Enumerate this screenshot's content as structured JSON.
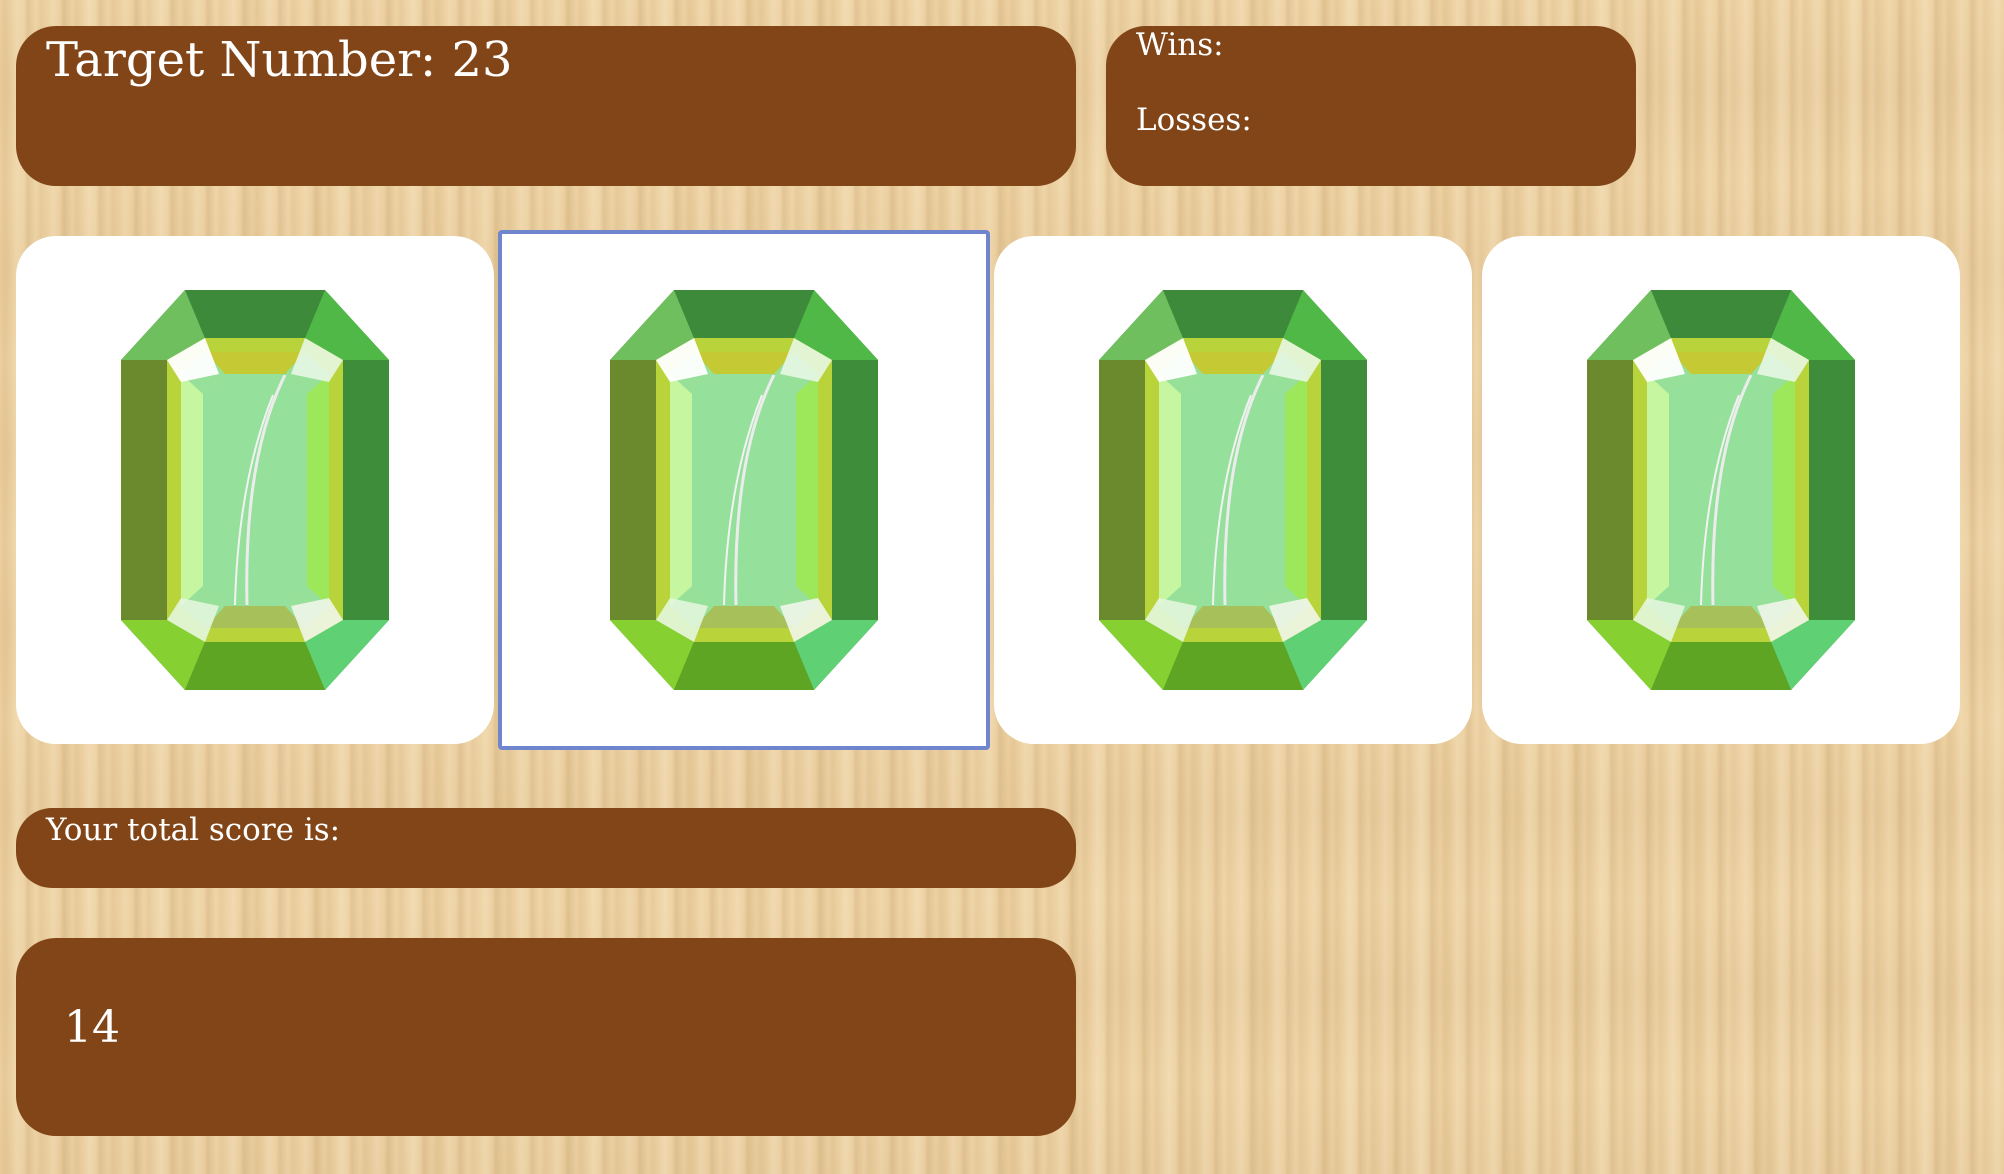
{
  "target": {
    "label": "Target Number:",
    "value": "23"
  },
  "stats": {
    "wins_label": "Wins:",
    "wins_value": "",
    "losses_label": "Losses:",
    "losses_value": ""
  },
  "score": {
    "label": "Your total score is:",
    "value": "14"
  },
  "crystals": [
    {
      "icon": "green-gem-icon",
      "focused": false
    },
    {
      "icon": "green-gem-icon",
      "focused": true
    },
    {
      "icon": "green-gem-icon",
      "focused": false
    },
    {
      "icon": "green-gem-icon",
      "focused": false
    }
  ],
  "colors": {
    "panel": "#824517",
    "focus_ring": "#6f86cf",
    "gem_dark": "#3e8a3a",
    "gem_mid": "#55c24a",
    "gem_light": "#97e09a",
    "gem_yellow": "#b7c93a"
  }
}
